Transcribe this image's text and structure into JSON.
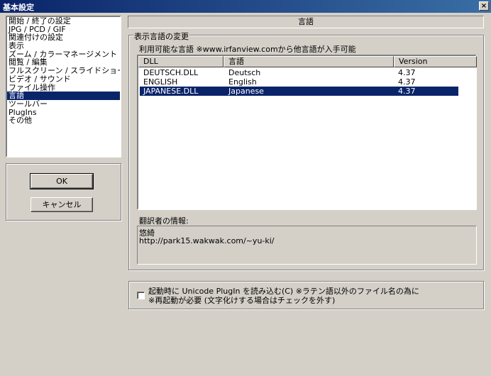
{
  "window": {
    "title": "基本設定",
    "close_glyph": "×"
  },
  "sidebar": {
    "items": [
      {
        "label": "開始 / 終了の設定",
        "selected": false
      },
      {
        "label": "JPG / PCD / GIF",
        "selected": false
      },
      {
        "label": "関連付けの設定",
        "selected": false
      },
      {
        "label": "表示",
        "selected": false
      },
      {
        "label": "ズーム / カラーマネージメント",
        "selected": false
      },
      {
        "label": "閲覧 / 編集",
        "selected": false
      },
      {
        "label": "フルスクリーン / スライドショー",
        "selected": false
      },
      {
        "label": "ビデオ / サウンド",
        "selected": false
      },
      {
        "label": "ファイル操作",
        "selected": false
      },
      {
        "label": "言語",
        "selected": true
      },
      {
        "label": "ツールバー",
        "selected": false
      },
      {
        "label": "PlugIns",
        "selected": false
      },
      {
        "label": "その他",
        "selected": false
      }
    ]
  },
  "buttons": {
    "ok": "OK",
    "cancel": "キャンセル"
  },
  "panel": {
    "header": "言語",
    "group_label": "表示言語の変更",
    "available_label": "利用可能な言語 ※www.irfanview.comから他言語が入手可能",
    "columns": [
      "DLL",
      "言語",
      "Version"
    ],
    "rows": [
      {
        "dll": "DEUTSCH.DLL",
        "lang": "Deutsch",
        "version": "4.37",
        "selected": false
      },
      {
        "dll": "ENGLISH",
        "lang": "English",
        "version": "4.37",
        "selected": false
      },
      {
        "dll": "JAPANESE.DLL",
        "lang": "Japanese",
        "version": "4.37",
        "selected": true
      }
    ],
    "translator_label": "翻訳者の情報:",
    "translator_name": "悠綺",
    "translator_url": "http://park15.wakwak.com/~yu-ki/"
  },
  "unicode": {
    "checked": false,
    "line1": "起動時に Unicode PlugIn を読み込む(C) ※ラテン語以外のファイル名の為に",
    "line2": "※再起動が必要 (文字化けする場合はチェックを外す)"
  }
}
